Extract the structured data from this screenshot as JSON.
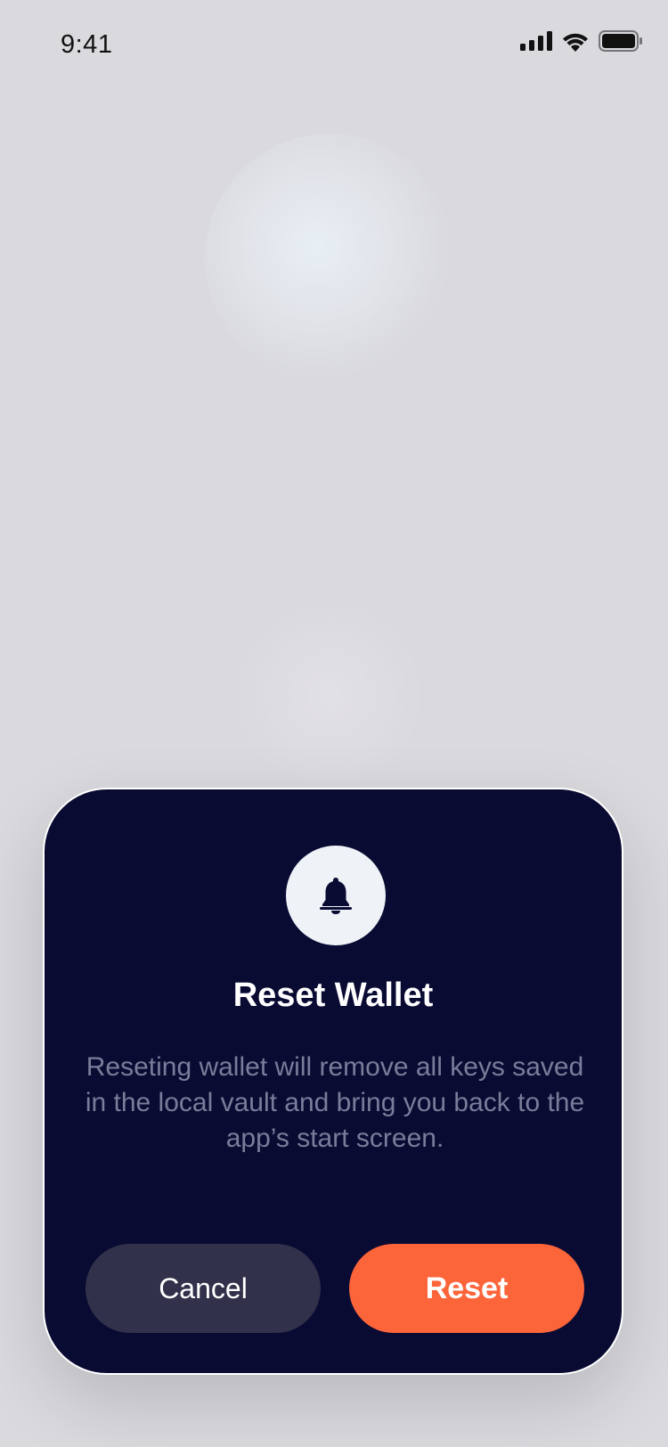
{
  "status_bar": {
    "time": "9:41"
  },
  "dialog": {
    "icon": "bell-icon",
    "title": "Reset Wallet",
    "message": "Reseting wallet will remove all keys saved in the local vault and bring you back to the app’s start screen.",
    "cancel_label": "Cancel",
    "reset_label": "Reset"
  },
  "colors": {
    "background": "#d9d9de",
    "dialog_background": "#0a0b33",
    "primary_button": "#fc643a",
    "secondary_button": "#31314b",
    "message_text": "#7b7c99"
  }
}
